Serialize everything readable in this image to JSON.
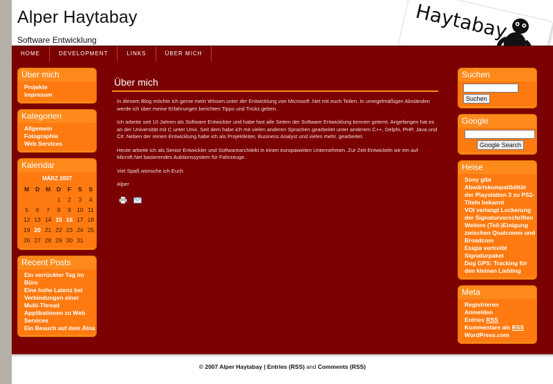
{
  "header": {
    "site_title": "Alper Haytabay",
    "tagline": "Software Entwicklung",
    "logo_text": "Haytabay"
  },
  "nav": {
    "items": [
      "HOME",
      "DEVELOPMENT",
      "LINKS",
      "ÜBER MICH"
    ]
  },
  "left_sidebar": {
    "about": {
      "title": "Über mich",
      "links": [
        "Projekte",
        "Impresum"
      ]
    },
    "categories": {
      "title": "Kategorien",
      "links": [
        "Allgemein",
        "Fotographie",
        "Web Services"
      ]
    },
    "calendar": {
      "title": "Kalendar",
      "caption": "MÄRZ 2007",
      "weekdays": [
        "M",
        "D",
        "M",
        "D",
        "F",
        "S",
        "S"
      ],
      "weeks": [
        [
          "",
          "",
          "",
          "1",
          "2",
          "3",
          "4"
        ],
        [
          "5",
          "6",
          "7",
          "8",
          "9",
          "10",
          "11"
        ],
        [
          "12",
          "13",
          "14",
          "15",
          "16",
          "17",
          "18"
        ],
        [
          "19",
          "20",
          "21",
          "22",
          "23",
          "24",
          "25"
        ],
        [
          "26",
          "27",
          "28",
          "29",
          "30",
          "31",
          ""
        ]
      ],
      "linked_days": [
        "15",
        "16",
        "20"
      ]
    },
    "recent_posts": {
      "title": "Recent Posts",
      "links": [
        "Ein verrückter Tag im Büro",
        "Eine hohe Latenz bei Verbindungen einer Multi-Thread Applikationen zu Web Services",
        "Ein Besuch auf dem Ätna"
      ]
    }
  },
  "main": {
    "title": "Über mich",
    "paragraphs": [
      "In diesem Blog möchte ich gerne mein Wissen unter der Entwicklung von Microsoft .Net mit euch Teilen. In unregelmäßigen Abständen werde ich über meine Erfahrungen berichten Tipps und Tricks geben.",
      "Ich arbeite seit 10 Jahren als Software Entwickler und habe fast alle Seiten der Software Entwicklung kennen gelernt. Angefangen hat es an der Universität mit C unter Unix. Seit dem habe ich mit vielen anderen Sprachen gearbeitet unter anderem C++, Delphi, PHP, Java und C#. Neben der reinen Entwicklung habe ich als Projektleiter, Business Analyst und vieles mehr. gearbeitet.",
      "Heute arbeite ich als Senior Entwickler und Softwarearchitekt in einen europaweiten Unternehmen. Zur Zeit Entwickeln wir ein auf Microft.Net basierendes Auktionssystem für Fahrzeuge.",
      "Viel Spaß wünsche ich Euch",
      "Alper"
    ],
    "icons": [
      "print-icon",
      "email-icon"
    ]
  },
  "right_sidebar": {
    "search": {
      "title": "Suchen",
      "button": "Suchen"
    },
    "google": {
      "title": "Google",
      "button": "Google Search"
    },
    "heise": {
      "title": "Heise",
      "links": [
        "Sony gibt Abwärtskompatibilität der Playstation 3 zu PS2-Titeln bekannt",
        "VOI verlangt Lockerung der Signaturvorschriften",
        "Weitere (Teil-)Einigung zwischen Qualcomm und Broadcom",
        "Esigia vertreibt Signaturpaket",
        "Dog GPS: Tracking für den kleinen Liebling"
      ]
    },
    "meta": {
      "title": "Meta",
      "registrieren": "Registrieren",
      "anmelden": "Anmelden",
      "entries_prefix": "Entries",
      "comments_prefix": "Kommentare als",
      "rss": "RSS",
      "wordpress": "WordPress.com"
    }
  },
  "footer": {
    "copyright": "© 2007 Alper Haytabay",
    "sep": "|",
    "entries": "Entries (RSS)",
    "and": "and",
    "comments": "Comments (RSS)"
  },
  "colors": {
    "content_bg": "#7b0000",
    "nav_bg": "#7a0000",
    "box_orange": "#ff8a1c",
    "page_bg": "#b4b0a8"
  }
}
